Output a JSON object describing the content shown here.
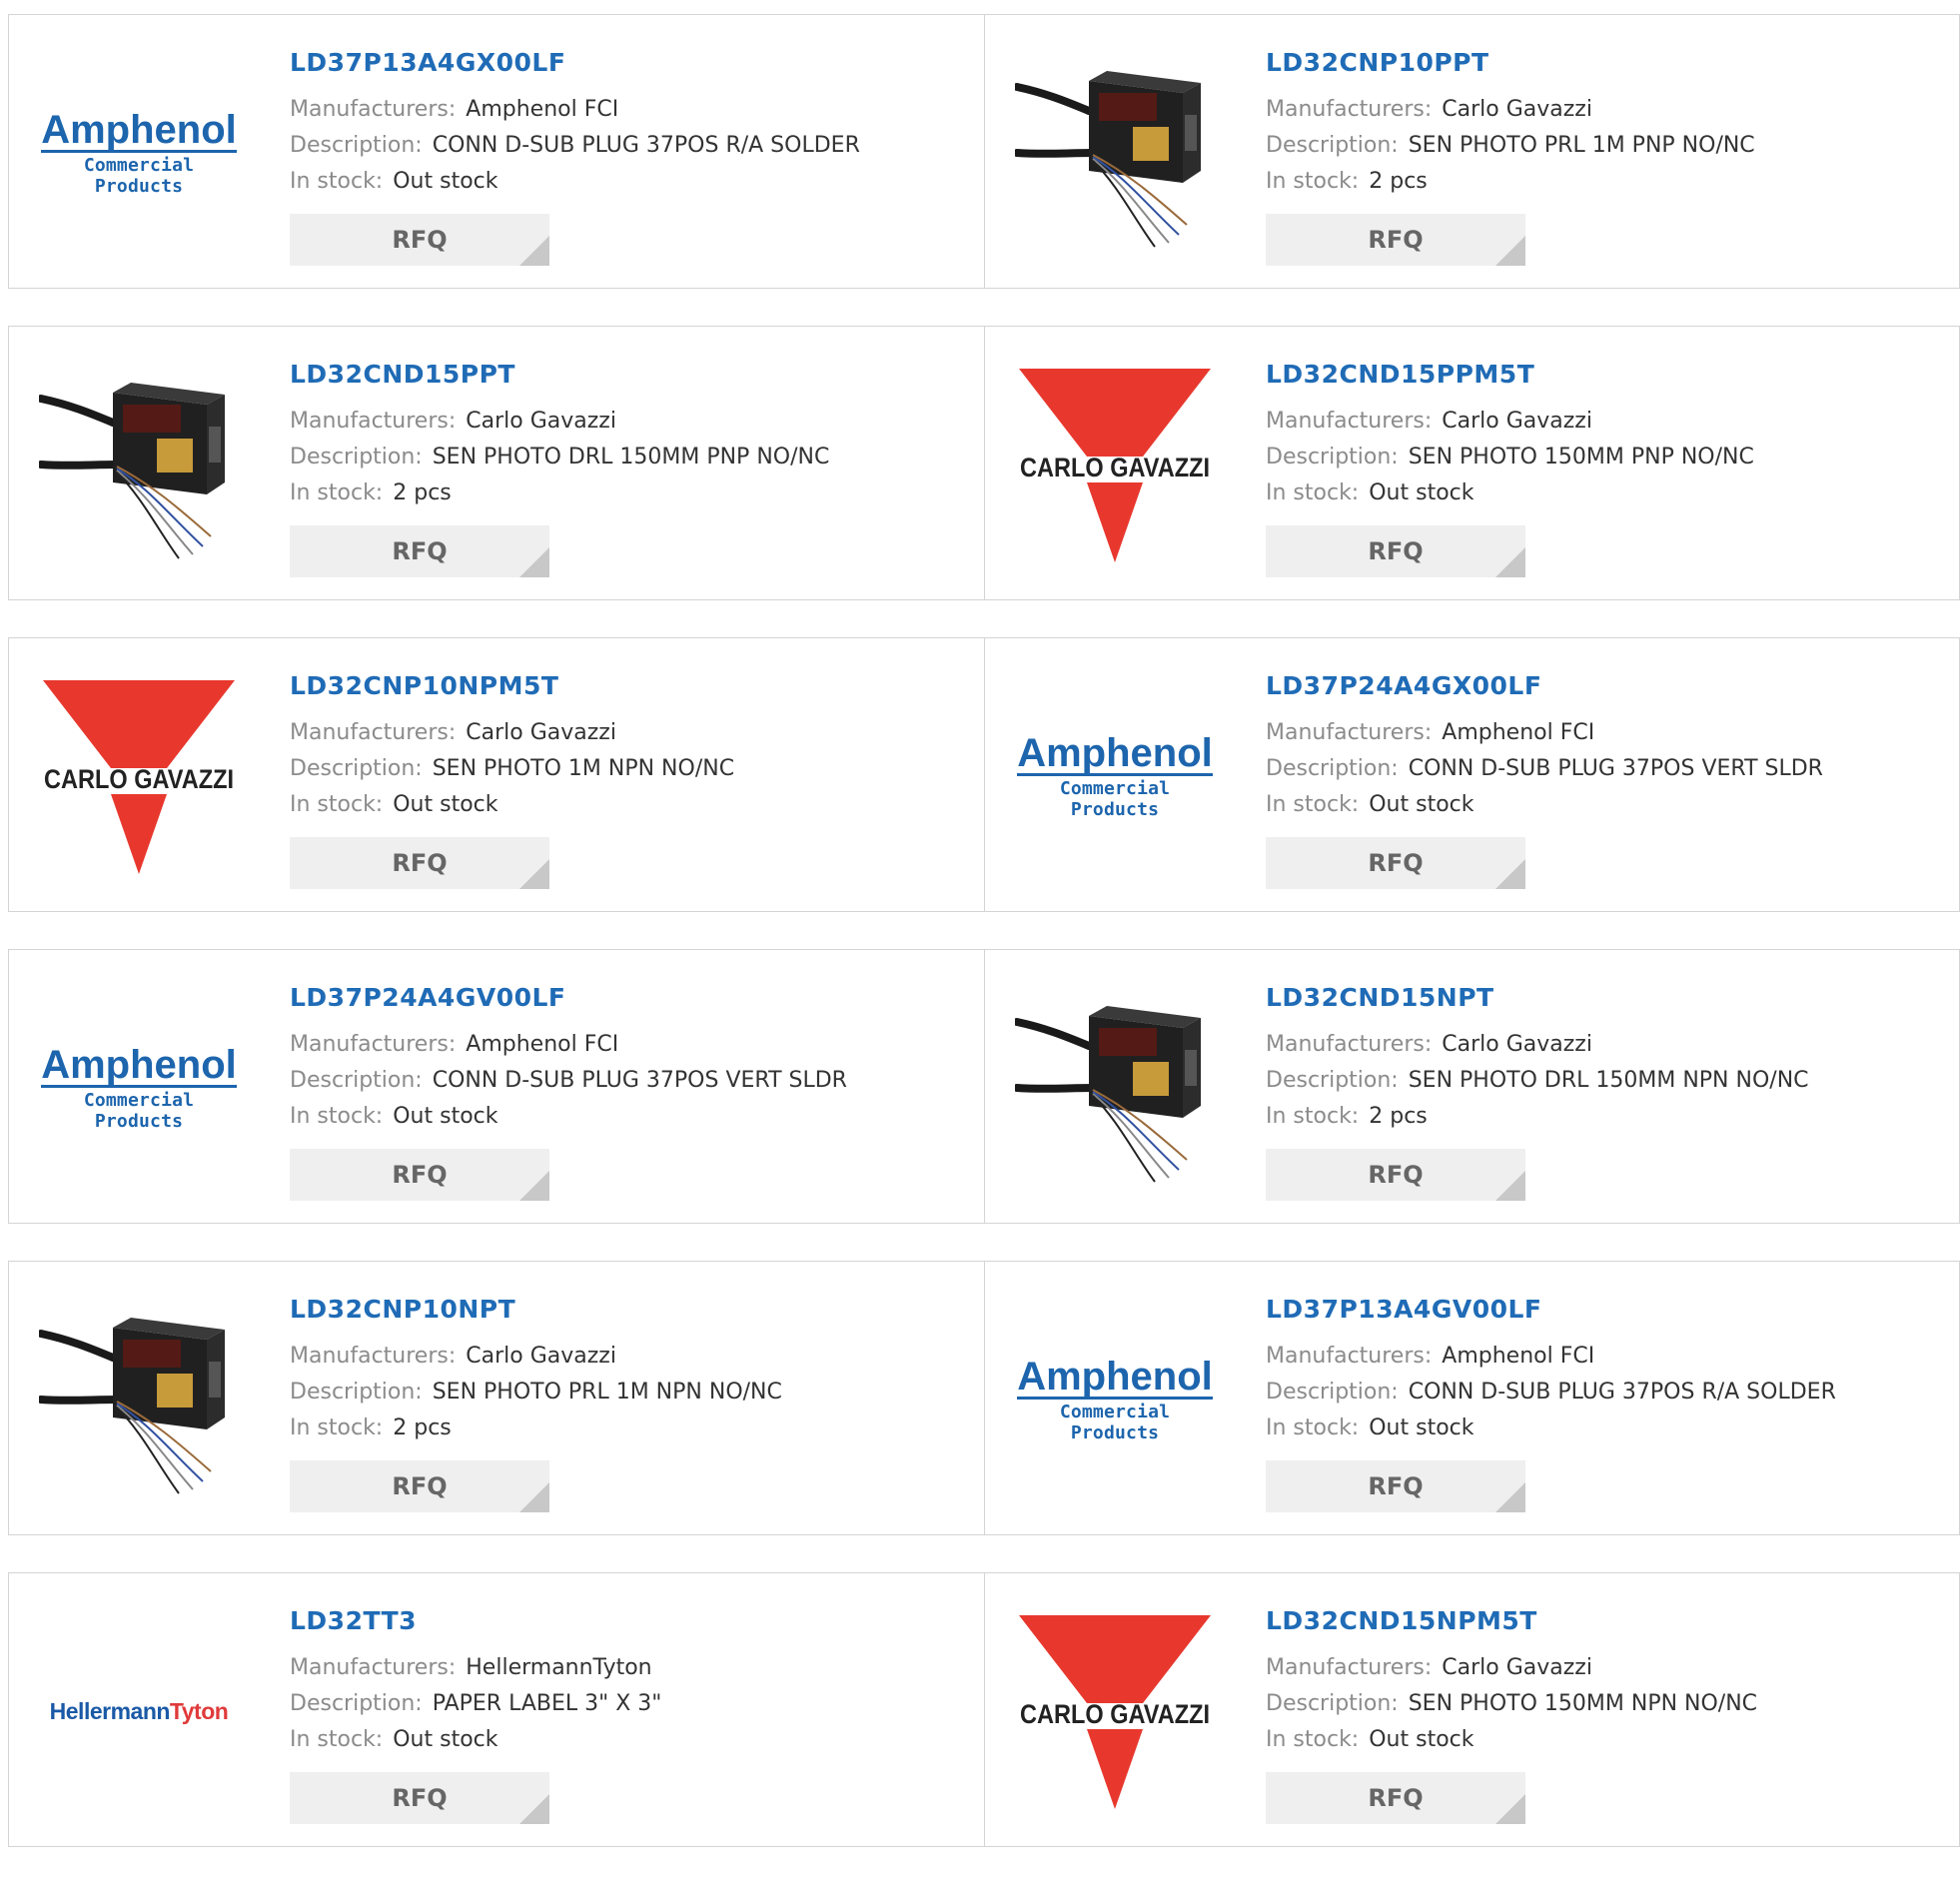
{
  "labels": {
    "manufacturers": "Manufacturers:",
    "description": "Description:",
    "in_stock": "In stock:",
    "rfq": "RFQ"
  },
  "brand_logos": {
    "amphenol": {
      "name": "Amphenol",
      "subtitle": "Commercial Products",
      "color": "#1d65ad"
    },
    "carlo_gavazzi": {
      "name": "CARLO GAVAZZI",
      "color": "#e8382e"
    },
    "hellermann": {
      "name_part1": "Hellermann",
      "name_part2": "Tyton",
      "color": "#1a59a6"
    }
  },
  "colors": {
    "part_link": "#1f6bb6",
    "label_gray": "#8b8b8b",
    "rfq_bg": "#efefef",
    "border": "#d4d4d4"
  },
  "products": [
    {
      "part": "LD37P13A4GX00LF",
      "manufacturer": "Amphenol FCI",
      "description": "CONN D-SUB PLUG 37POS R/A SOLDER",
      "stock": "Out stock",
      "image": "amphenol-logo"
    },
    {
      "part": "LD32CNP10PPT",
      "manufacturer": "Carlo Gavazzi",
      "description": "SEN PHOTO PRL 1M PNP NO/NC",
      "stock": "2 pcs",
      "image": "photo-sensor"
    },
    {
      "part": "LD32CND15PPT",
      "manufacturer": "Carlo Gavazzi",
      "description": "SEN PHOTO DRL 150MM PNP NO/NC",
      "stock": "2 pcs",
      "image": "photo-sensor"
    },
    {
      "part": "LD32CND15PPM5T",
      "manufacturer": "Carlo Gavazzi",
      "description": "SEN PHOTO 150MM PNP NO/NC",
      "stock": "Out stock",
      "image": "carlo-gavazzi-logo"
    },
    {
      "part": "LD32CNP10NPM5T",
      "manufacturer": "Carlo Gavazzi",
      "description": "SEN PHOTO 1M NPN NO/NC",
      "stock": "Out stock",
      "image": "carlo-gavazzi-logo"
    },
    {
      "part": "LD37P24A4GX00LF",
      "manufacturer": "Amphenol FCI",
      "description": "CONN D-SUB PLUG 37POS VERT SLDR",
      "stock": "Out stock",
      "image": "amphenol-logo"
    },
    {
      "part": "LD37P24A4GV00LF",
      "manufacturer": "Amphenol FCI",
      "description": "CONN D-SUB PLUG 37POS VERT SLDR",
      "stock": "Out stock",
      "image": "amphenol-logo"
    },
    {
      "part": "LD32CND15NPT",
      "manufacturer": "Carlo Gavazzi",
      "description": "SEN PHOTO DRL 150MM NPN NO/NC",
      "stock": "2 pcs",
      "image": "photo-sensor"
    },
    {
      "part": "LD32CNP10NPT",
      "manufacturer": "Carlo Gavazzi",
      "description": "SEN PHOTO PRL 1M NPN NO/NC",
      "stock": "2 pcs",
      "image": "photo-sensor"
    },
    {
      "part": "LD37P13A4GV00LF",
      "manufacturer": "Amphenol FCI",
      "description": "CONN D-SUB PLUG 37POS R/A SOLDER",
      "stock": "Out stock",
      "image": "amphenol-logo"
    },
    {
      "part": "LD32TT3",
      "manufacturer": "HellermannTyton",
      "description": "PAPER LABEL 3\" X 3\"",
      "stock": "Out stock",
      "image": "hellermann-tyton-logo"
    },
    {
      "part": "LD32CND15NPM5T",
      "manufacturer": "Carlo Gavazzi",
      "description": "SEN PHOTO 150MM NPN NO/NC",
      "stock": "Out stock",
      "image": "carlo-gavazzi-logo"
    }
  ]
}
